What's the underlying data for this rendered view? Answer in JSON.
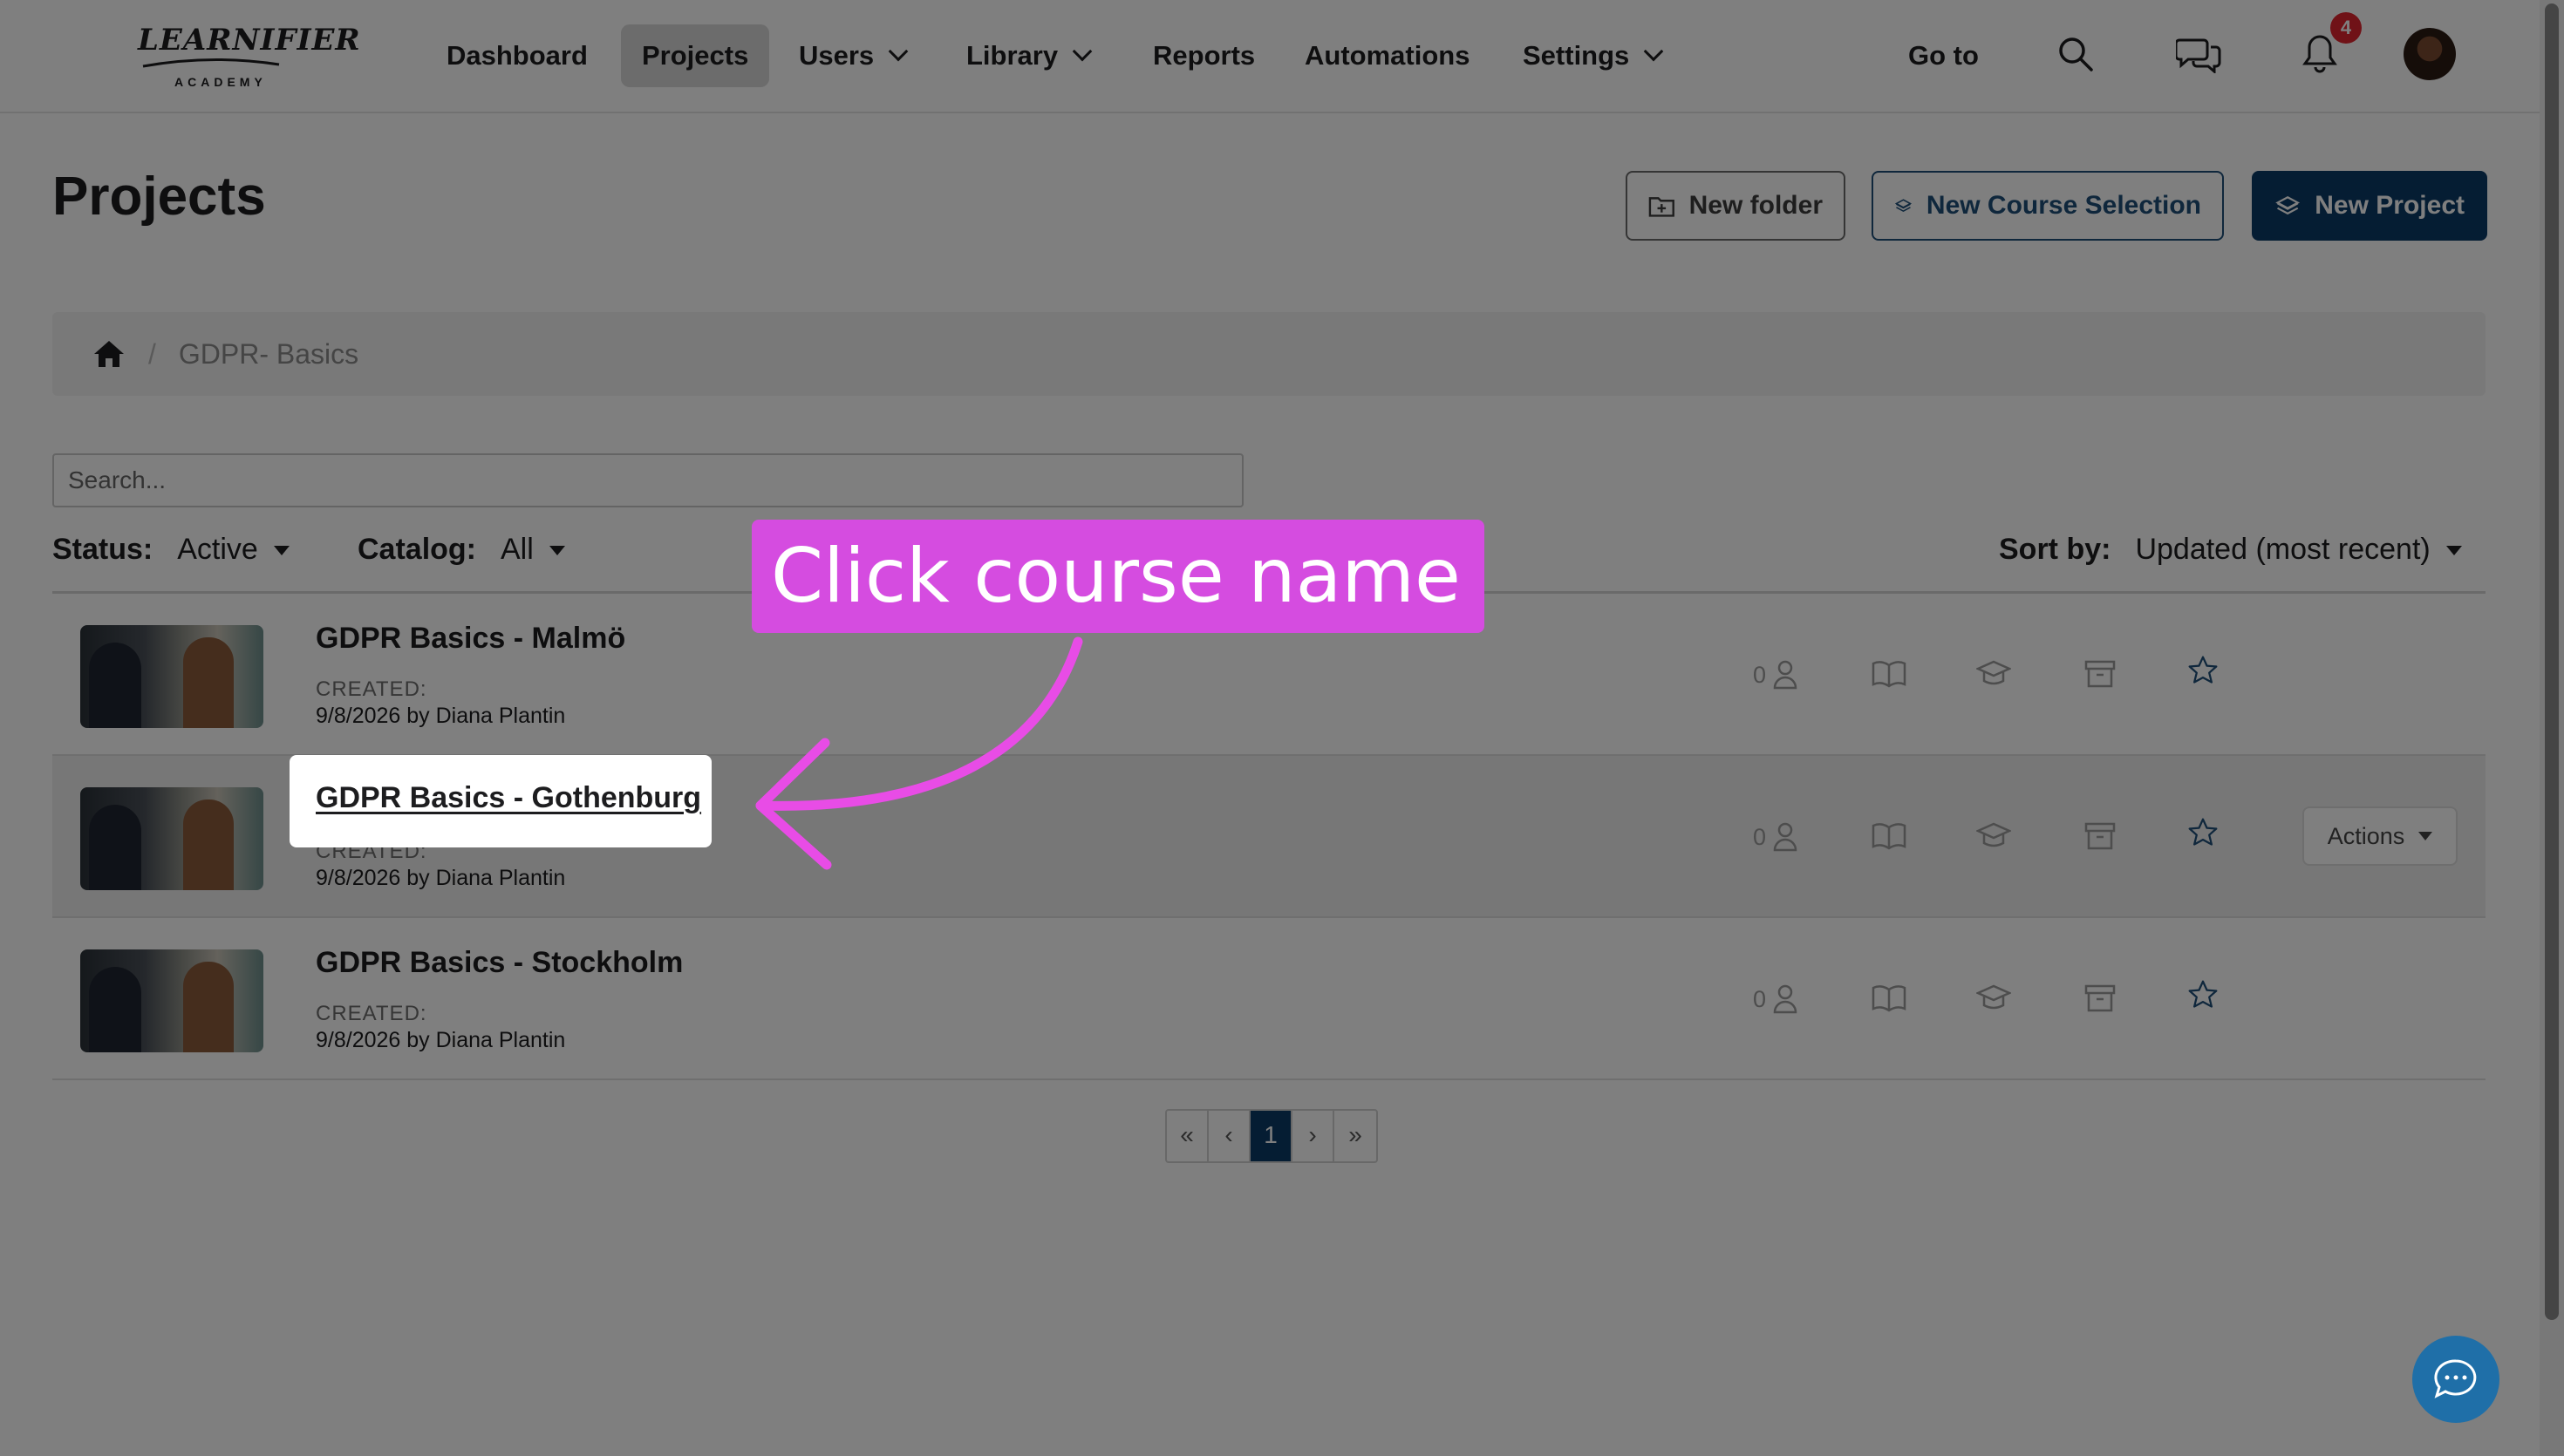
{
  "brand": {
    "logo_text": "LEARNIFIER",
    "logo_sub": "ACADEMY"
  },
  "nav": {
    "dashboard": "Dashboard",
    "projects": "Projects",
    "users": "Users",
    "library": "Library",
    "reports": "Reports",
    "automations": "Automations",
    "settings": "Settings",
    "go_to": "Go to",
    "notification_count": "4"
  },
  "page": {
    "title": "Projects",
    "new_folder": "New folder",
    "new_course_selection": "New Course Selection",
    "new_project": "New Project"
  },
  "breadcrumb": {
    "current": "GDPR- Basics"
  },
  "search": {
    "placeholder": "Search..."
  },
  "filters": {
    "status_label": "Status:",
    "status_value": "Active",
    "catalog_label": "Catalog:",
    "catalog_value": "All",
    "sort_label": "Sort by:",
    "sort_value": "Updated (most recent)"
  },
  "projects": [
    {
      "name": "GDPR Basics - Malmö",
      "created_label": "CREATED:",
      "created": "9/8/2026 by Diana Plantin",
      "users": "0"
    },
    {
      "name": "GDPR Basics - Gothenburg",
      "created_label": "CREATED:",
      "created": "9/8/2026 by Diana Plantin",
      "users": "0",
      "actions": "Actions"
    },
    {
      "name": "GDPR Basics - Stockholm",
      "created_label": "CREATED:",
      "created": "9/8/2026 by Diana Plantin",
      "users": "0"
    }
  ],
  "pagination": {
    "first": "«",
    "prev": "‹",
    "current": "1",
    "next": "›",
    "last": "»"
  },
  "annotation": {
    "callout": "Click course name",
    "color": "#d54ce0"
  }
}
